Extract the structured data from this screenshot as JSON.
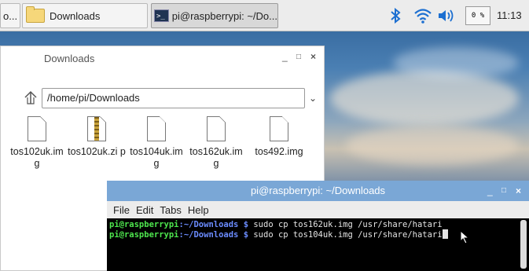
{
  "taskbar": {
    "menu_stub": "o...",
    "tasks": [
      {
        "label": "Downloads",
        "icon": "folder-icon"
      },
      {
        "label": "pi@raspberrypi: ~/Do...",
        "icon": "terminal-icon"
      }
    ],
    "tray": {
      "bluetooth_icon": "bluetooth-icon",
      "wifi_icon": "wifi-icon",
      "volume_icon": "volume-icon",
      "cpu_usage": "0 %",
      "clock": "11:13"
    }
  },
  "file_manager": {
    "title": "Downloads",
    "minimize": "_",
    "maximize": "□",
    "close": "×",
    "path": "/home/pi/Downloads",
    "files": [
      {
        "name": "tos102uk.im g",
        "type": "img"
      },
      {
        "name": "tos102uk.zi p",
        "type": "zip"
      },
      {
        "name": "tos104uk.im g",
        "type": "img"
      },
      {
        "name": "tos162uk.im g",
        "type": "img"
      },
      {
        "name": "tos492.img",
        "type": "img"
      }
    ]
  },
  "terminal": {
    "title": "pi@raspberrypi: ~/Downloads",
    "minimize": "_",
    "maximize": "□",
    "close": "×",
    "menu": [
      "File",
      "Edit",
      "Tabs",
      "Help"
    ],
    "lines": [
      {
        "user": "pi@raspberrypi",
        "path": ":~/Downloads $",
        "cmd": " sudo cp tos162uk.img /usr/share/hatari"
      },
      {
        "user": "pi@raspberrypi",
        "path": ":~/Downloads $",
        "cmd": " sudo cp tos104uk.img /usr/share/hatari"
      }
    ]
  }
}
